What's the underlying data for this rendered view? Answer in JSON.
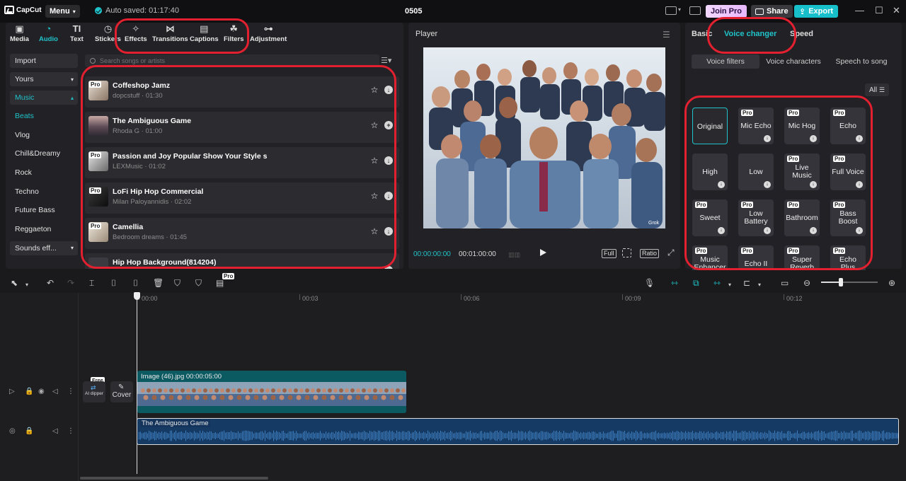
{
  "app": {
    "logo_text": "CapCut",
    "menu_label": "Menu",
    "autosave": "Auto saved: 01:17:40",
    "project_title": "0505",
    "join_pro": "Join Pro",
    "share": "Share",
    "export": "Export"
  },
  "toolbar": {
    "tabs": [
      {
        "label": "Media",
        "icon": "media-icon"
      },
      {
        "label": "Audio",
        "icon": "audio-icon"
      },
      {
        "label": "Text",
        "icon": "text-icon"
      },
      {
        "label": "Stickers",
        "icon": "stickers-icon"
      },
      {
        "label": "Effects",
        "icon": "effects-icon"
      },
      {
        "label": "Transitions",
        "icon": "transitions-icon"
      },
      {
        "label": "Captions",
        "icon": "captions-icon"
      },
      {
        "label": "Filters",
        "icon": "filters-icon"
      },
      {
        "label": "Adjustment",
        "icon": "adjustment-icon"
      }
    ],
    "active": "Audio"
  },
  "audio_categories": {
    "import": "Import",
    "yours": "Yours",
    "music": "Music",
    "subs": [
      "Beats",
      "Vlog",
      "Chill&Dreamy",
      "Rock",
      "Techno",
      "Future Bass",
      "Reggaeton"
    ],
    "sound_effects": "Sounds eff..."
  },
  "search": {
    "placeholder": "Search songs or artists"
  },
  "songs": [
    {
      "title": "Coffeshop Jamz",
      "meta": "dopcstuff · 01:30",
      "pro": "Pro",
      "action": "download"
    },
    {
      "title": "The Ambiguous Game",
      "meta": "Rhoda G · 01:00",
      "pro": "",
      "action": "add"
    },
    {
      "title": "Passion and Joy Popular Show Your Style s",
      "meta": "LEXMusic · 01:02",
      "pro": "Pro",
      "action": "download"
    },
    {
      "title": "LoFi Hip Hop Commercial",
      "meta": "Milan Paloyannidis · 02:02",
      "pro": "Pro",
      "action": "download"
    },
    {
      "title": "Camellia",
      "meta": "Bedroom dreams · 01:45",
      "pro": "Pro",
      "action": "download"
    },
    {
      "title": "Hip Hop Background(814204)",
      "meta": "",
      "pro": "",
      "action": "add"
    }
  ],
  "player": {
    "title": "Player",
    "current_time": "00:00:00:00",
    "duration": "00:01:00:00",
    "full": "Full",
    "ratio": "Ratio",
    "watermark": "Grok"
  },
  "right_panel": {
    "tabs": [
      "Basic",
      "Voice changer",
      "Speed"
    ],
    "active_tab": "Voice changer",
    "subtabs": [
      "Voice filters",
      "Voice characters",
      "Speech to song"
    ],
    "active_subtab": "Voice filters",
    "filter_all": "All",
    "voices": [
      {
        "name": "Original",
        "pro": false,
        "download": false
      },
      {
        "name": "Mic Echo",
        "pro": true,
        "download": true
      },
      {
        "name": "Mic Hog",
        "pro": true,
        "download": true
      },
      {
        "name": "Echo",
        "pro": true,
        "download": true
      },
      {
        "name": "High",
        "pro": false,
        "download": true
      },
      {
        "name": "Low",
        "pro": false,
        "download": true
      },
      {
        "name": "Live Music",
        "pro": true,
        "download": true
      },
      {
        "name": "Full Voice",
        "pro": true,
        "download": true
      },
      {
        "name": "Sweet",
        "pro": true,
        "download": true
      },
      {
        "name": "Low Battery",
        "pro": true,
        "download": true
      },
      {
        "name": "Bathroom",
        "pro": true,
        "download": true
      },
      {
        "name": "Bass Boost",
        "pro": true,
        "download": true
      },
      {
        "name": "Music Enhancer",
        "pro": true,
        "download": false
      },
      {
        "name": "Echo II",
        "pro": true,
        "download": false
      },
      {
        "name": "Super Reverb",
        "pro": true,
        "download": false
      },
      {
        "name": "Echo Plus",
        "pro": true,
        "download": false
      }
    ],
    "pro_label": "Pro"
  },
  "timeline": {
    "pro_label": "Pro",
    "ruler": [
      "00:00",
      "00:03",
      "00:06",
      "00:09",
      "00:12"
    ],
    "ai_dipper_label": "AI dipper",
    "free_label": "Free",
    "cover_label": "Cover",
    "video_clip": "Image (46).jpg  00:00:05:00",
    "audio_clip": "The Ambiguous Game"
  },
  "colors": {
    "accent": "#1fc3c9",
    "annotation": "#e2202f",
    "audio_track": "#153a63",
    "video_track": "#0b5a62"
  }
}
